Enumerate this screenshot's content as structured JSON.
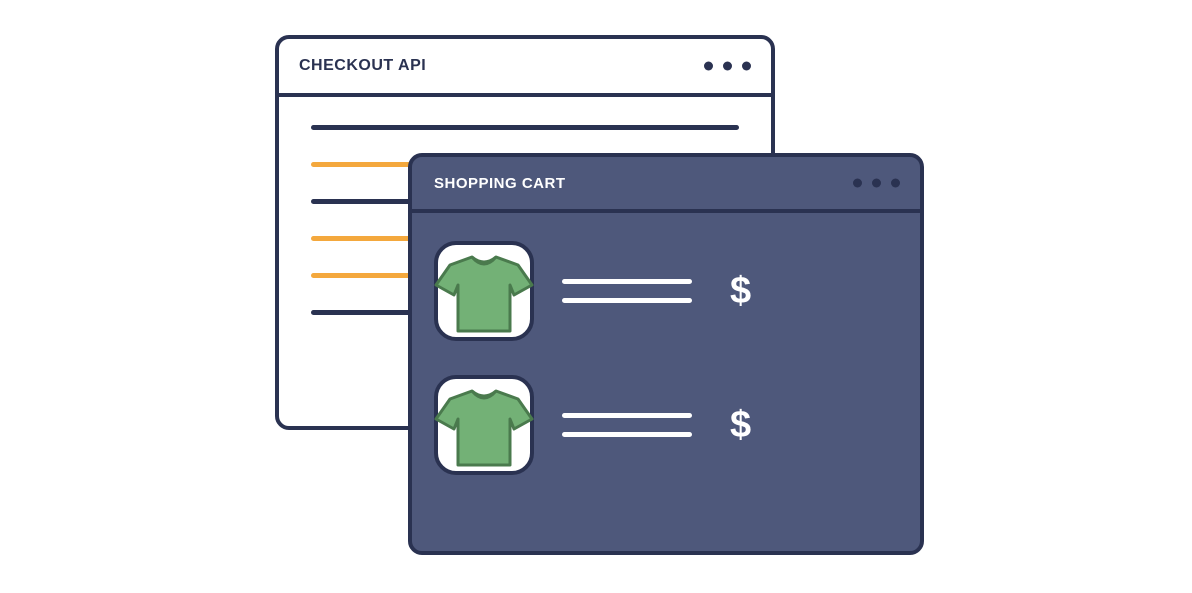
{
  "back_window": {
    "title": "CHECKOUT API",
    "lines": [
      {
        "color": "dark"
      },
      {
        "color": "orange"
      },
      {
        "color": "dark"
      },
      {
        "color": "orange"
      },
      {
        "color": "orange"
      },
      {
        "color": "dark"
      }
    ]
  },
  "front_window": {
    "title": "SHOPPING CART",
    "items": [
      {
        "icon": "tshirt",
        "price_symbol": "$"
      },
      {
        "icon": "tshirt",
        "price_symbol": "$"
      }
    ]
  },
  "colors": {
    "dark": "#2a3251",
    "slate": "#4e587b",
    "orange": "#f4a83d",
    "green": "#73b176",
    "green_dark": "#4a7a4d",
    "white": "#ffffff"
  }
}
